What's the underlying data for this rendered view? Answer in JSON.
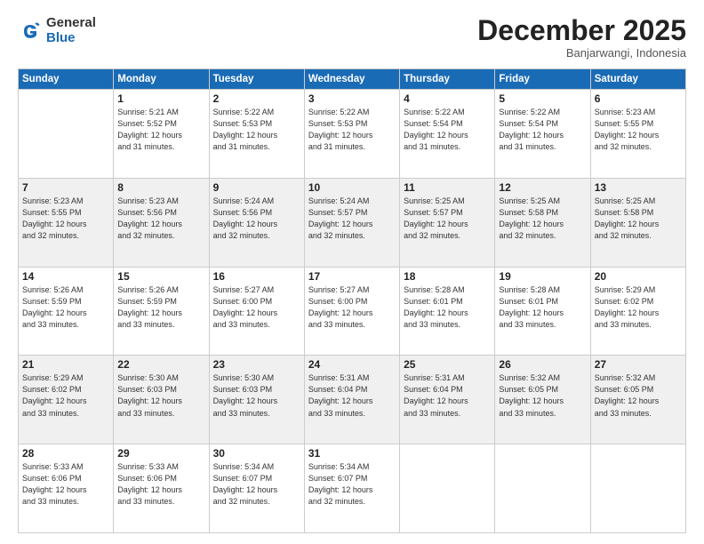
{
  "header": {
    "logo_general": "General",
    "logo_blue": "Blue",
    "month_title": "December 2025",
    "location": "Banjarwangi, Indonesia"
  },
  "weekdays": [
    "Sunday",
    "Monday",
    "Tuesday",
    "Wednesday",
    "Thursday",
    "Friday",
    "Saturday"
  ],
  "weeks": [
    [
      {
        "day": "",
        "info": ""
      },
      {
        "day": "1",
        "info": "Sunrise: 5:21 AM\nSunset: 5:52 PM\nDaylight: 12 hours\nand 31 minutes."
      },
      {
        "day": "2",
        "info": "Sunrise: 5:22 AM\nSunset: 5:53 PM\nDaylight: 12 hours\nand 31 minutes."
      },
      {
        "day": "3",
        "info": "Sunrise: 5:22 AM\nSunset: 5:53 PM\nDaylight: 12 hours\nand 31 minutes."
      },
      {
        "day": "4",
        "info": "Sunrise: 5:22 AM\nSunset: 5:54 PM\nDaylight: 12 hours\nand 31 minutes."
      },
      {
        "day": "5",
        "info": "Sunrise: 5:22 AM\nSunset: 5:54 PM\nDaylight: 12 hours\nand 31 minutes."
      },
      {
        "day": "6",
        "info": "Sunrise: 5:23 AM\nSunset: 5:55 PM\nDaylight: 12 hours\nand 32 minutes."
      }
    ],
    [
      {
        "day": "7",
        "info": "Sunrise: 5:23 AM\nSunset: 5:55 PM\nDaylight: 12 hours\nand 32 minutes."
      },
      {
        "day": "8",
        "info": "Sunrise: 5:23 AM\nSunset: 5:56 PM\nDaylight: 12 hours\nand 32 minutes."
      },
      {
        "day": "9",
        "info": "Sunrise: 5:24 AM\nSunset: 5:56 PM\nDaylight: 12 hours\nand 32 minutes."
      },
      {
        "day": "10",
        "info": "Sunrise: 5:24 AM\nSunset: 5:57 PM\nDaylight: 12 hours\nand 32 minutes."
      },
      {
        "day": "11",
        "info": "Sunrise: 5:25 AM\nSunset: 5:57 PM\nDaylight: 12 hours\nand 32 minutes."
      },
      {
        "day": "12",
        "info": "Sunrise: 5:25 AM\nSunset: 5:58 PM\nDaylight: 12 hours\nand 32 minutes."
      },
      {
        "day": "13",
        "info": "Sunrise: 5:25 AM\nSunset: 5:58 PM\nDaylight: 12 hours\nand 32 minutes."
      }
    ],
    [
      {
        "day": "14",
        "info": "Sunrise: 5:26 AM\nSunset: 5:59 PM\nDaylight: 12 hours\nand 33 minutes."
      },
      {
        "day": "15",
        "info": "Sunrise: 5:26 AM\nSunset: 5:59 PM\nDaylight: 12 hours\nand 33 minutes."
      },
      {
        "day": "16",
        "info": "Sunrise: 5:27 AM\nSunset: 6:00 PM\nDaylight: 12 hours\nand 33 minutes."
      },
      {
        "day": "17",
        "info": "Sunrise: 5:27 AM\nSunset: 6:00 PM\nDaylight: 12 hours\nand 33 minutes."
      },
      {
        "day": "18",
        "info": "Sunrise: 5:28 AM\nSunset: 6:01 PM\nDaylight: 12 hours\nand 33 minutes."
      },
      {
        "day": "19",
        "info": "Sunrise: 5:28 AM\nSunset: 6:01 PM\nDaylight: 12 hours\nand 33 minutes."
      },
      {
        "day": "20",
        "info": "Sunrise: 5:29 AM\nSunset: 6:02 PM\nDaylight: 12 hours\nand 33 minutes."
      }
    ],
    [
      {
        "day": "21",
        "info": "Sunrise: 5:29 AM\nSunset: 6:02 PM\nDaylight: 12 hours\nand 33 minutes."
      },
      {
        "day": "22",
        "info": "Sunrise: 5:30 AM\nSunset: 6:03 PM\nDaylight: 12 hours\nand 33 minutes."
      },
      {
        "day": "23",
        "info": "Sunrise: 5:30 AM\nSunset: 6:03 PM\nDaylight: 12 hours\nand 33 minutes."
      },
      {
        "day": "24",
        "info": "Sunrise: 5:31 AM\nSunset: 6:04 PM\nDaylight: 12 hours\nand 33 minutes."
      },
      {
        "day": "25",
        "info": "Sunrise: 5:31 AM\nSunset: 6:04 PM\nDaylight: 12 hours\nand 33 minutes."
      },
      {
        "day": "26",
        "info": "Sunrise: 5:32 AM\nSunset: 6:05 PM\nDaylight: 12 hours\nand 33 minutes."
      },
      {
        "day": "27",
        "info": "Sunrise: 5:32 AM\nSunset: 6:05 PM\nDaylight: 12 hours\nand 33 minutes."
      }
    ],
    [
      {
        "day": "28",
        "info": "Sunrise: 5:33 AM\nSunset: 6:06 PM\nDaylight: 12 hours\nand 33 minutes."
      },
      {
        "day": "29",
        "info": "Sunrise: 5:33 AM\nSunset: 6:06 PM\nDaylight: 12 hours\nand 33 minutes."
      },
      {
        "day": "30",
        "info": "Sunrise: 5:34 AM\nSunset: 6:07 PM\nDaylight: 12 hours\nand 32 minutes."
      },
      {
        "day": "31",
        "info": "Sunrise: 5:34 AM\nSunset: 6:07 PM\nDaylight: 12 hours\nand 32 minutes."
      },
      {
        "day": "",
        "info": ""
      },
      {
        "day": "",
        "info": ""
      },
      {
        "day": "",
        "info": ""
      }
    ]
  ]
}
